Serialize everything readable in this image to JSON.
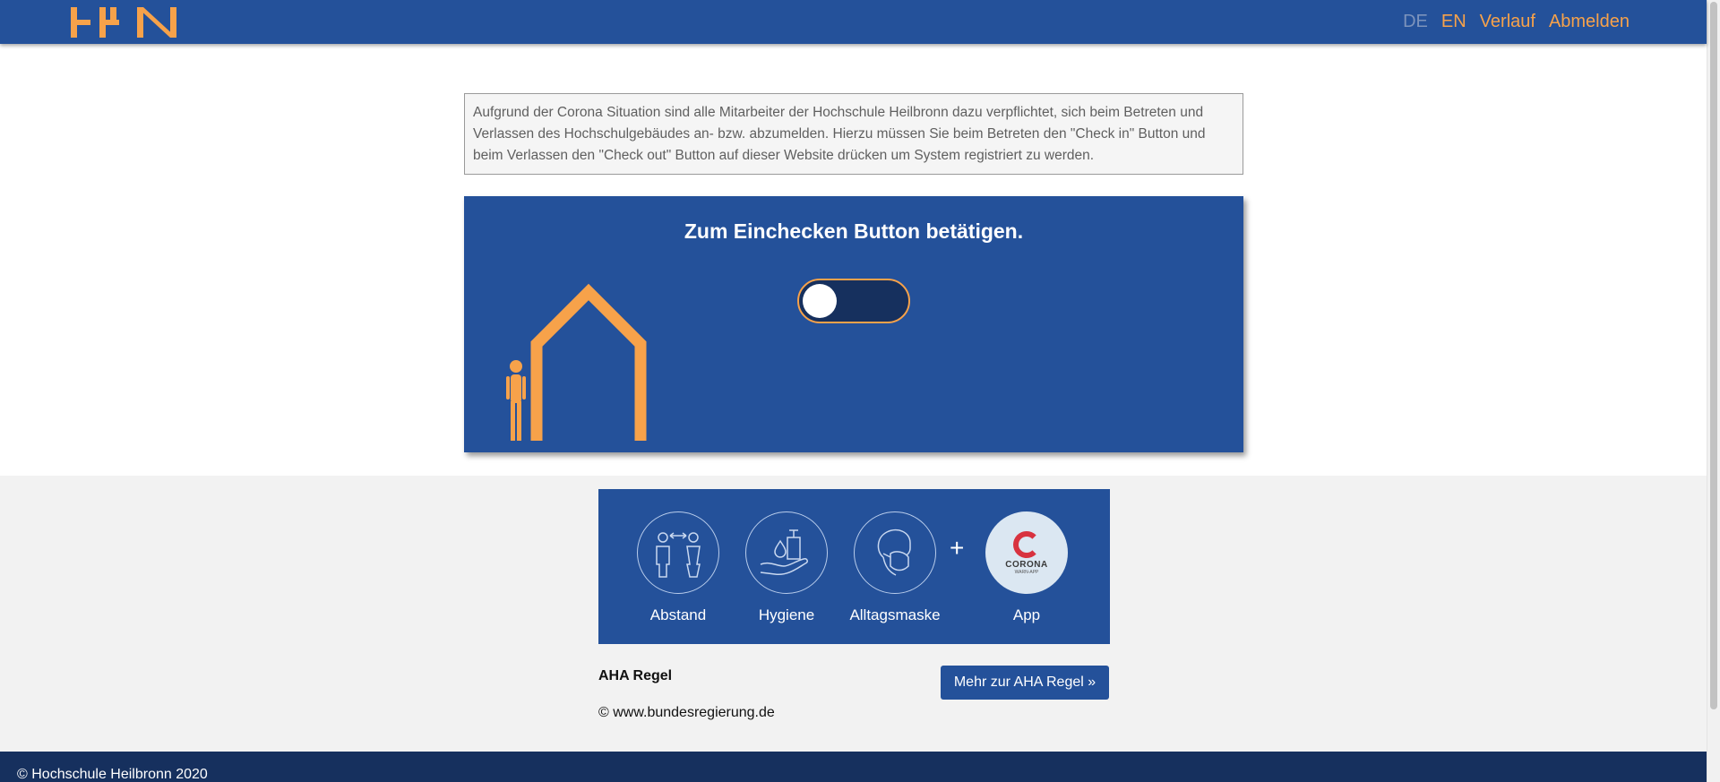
{
  "navbar": {
    "logo_text": "HHN",
    "links": {
      "de": "DE",
      "en": "EN",
      "history": "Verlauf",
      "logout": "Abmelden"
    },
    "accent_color": "#f7a24a",
    "background_color": "#24519a"
  },
  "notice": {
    "text": "Aufgrund der Corona Situation sind alle Mitarbeiter der Hochschule Heilbronn dazu verpflichtet, sich beim Betreten und Verlassen des Hochschulgebäudes an- bzw. abzumelden. Hierzu müssen Sie beim Betreten den \"Check in\" Button und beim Verlassen den \"Check out\" Button auf dieser Website drücken um System registriert zu werden."
  },
  "checkin": {
    "title": "Zum Einchecken Button betätigen.",
    "toggle_state": "off",
    "illustration": "person-house-icon"
  },
  "aha": {
    "items": [
      {
        "label": "Abstand",
        "icon": "distance-icon"
      },
      {
        "label": "Hygiene",
        "icon": "handwashing-icon"
      },
      {
        "label": "Alltagsmaske",
        "icon": "mask-icon"
      }
    ],
    "plus": "+",
    "app": {
      "label": "App",
      "icon": "corona-warn-app-icon",
      "logo_title": "CORONA",
      "logo_subtitle": "WARN-APP"
    },
    "title": "AHA Regel",
    "copyright": "© www.bundesregierung.de",
    "button_label": "Mehr zur AHA Regel »"
  },
  "footer": {
    "text": "© Hochschule Heilbronn 2020"
  }
}
